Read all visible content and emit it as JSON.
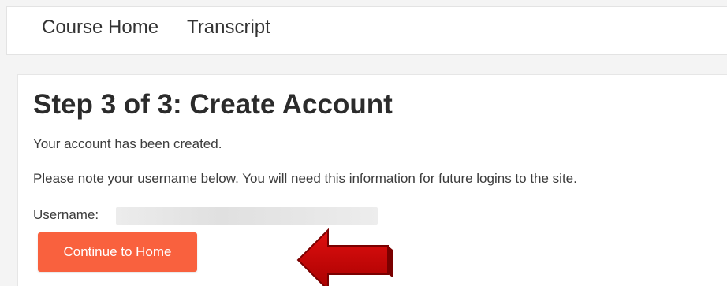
{
  "nav": {
    "course_home": "Course Home",
    "transcript": "Transcript"
  },
  "main": {
    "title": "Step 3 of 3: Create Account",
    "created_message": "Your account has been created.",
    "note_message": "Please note your username below. You will need this information for future logins to the site.",
    "username_label": "Username:",
    "continue_button": "Continue to Home"
  },
  "annotation": {
    "arrow_icon": "red-left-arrow-icon",
    "arrow_color": "#c50000"
  },
  "colors": {
    "button_accent": "#f9613e",
    "page_background": "#f4f4f4"
  }
}
